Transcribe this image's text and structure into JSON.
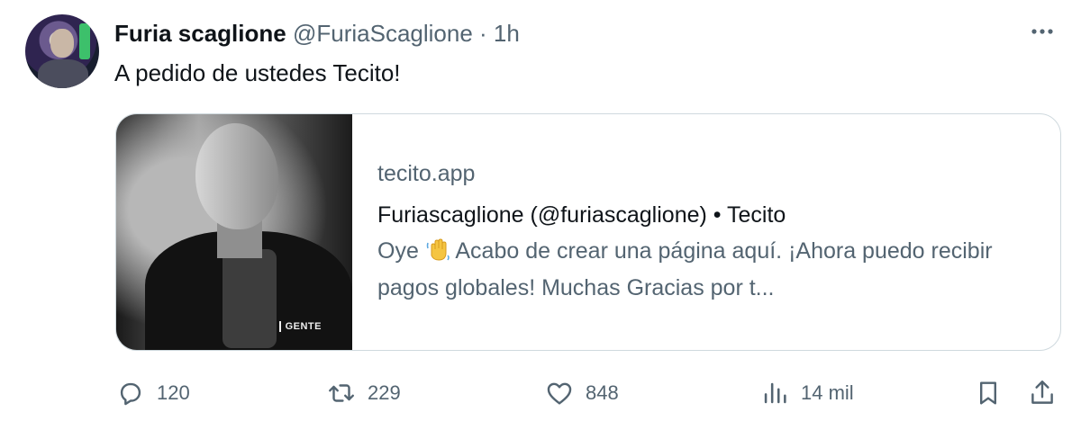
{
  "tweet": {
    "author_name": "Furia scaglione",
    "handle": "@FuriaScaglione",
    "separator": " · ",
    "time": "1h",
    "text": "A pedido de ustedes Tecito!",
    "more_icon": "more-icon"
  },
  "card": {
    "domain": "tecito.app",
    "title": "Furiascaglione (@furiascaglione) • Tecito",
    "desc_before_emoji": "Oye ",
    "desc_after_emoji": " Acabo de crear una página aquí. ¡Ahora puedo recibir pagos globales! Muchas Gracias por t...",
    "thumbnail_logo": "GENTE"
  },
  "actions": {
    "replies": "120",
    "retweets": "229",
    "likes": "848",
    "views": "14 mil"
  },
  "colors": {
    "text_primary": "#0f1419",
    "text_secondary": "#536471",
    "border": "#cfd9de"
  }
}
